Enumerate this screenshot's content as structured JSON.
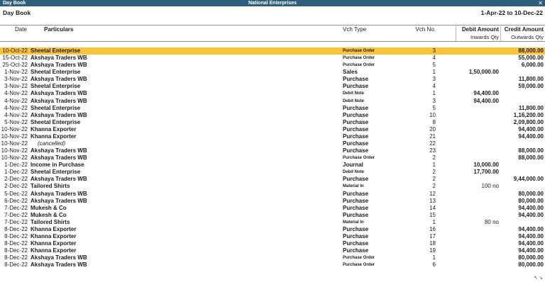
{
  "window": {
    "left_title": "Day Book",
    "company": "National Enterprises",
    "close_glyph": "✕"
  },
  "report": {
    "title": "Day Book",
    "period": "1-Apr-22 to 10-Dec-22"
  },
  "columns": {
    "date": "Date",
    "particulars": "Particulars",
    "vch_type": "Vch Type",
    "vch_no": "Vch No.",
    "debit": "Debit Amount",
    "credit": "Credit Amount",
    "debit_sub": "Inwards Qty",
    "credit_sub": "Outwards Qty"
  },
  "rows": [
    {
      "date": "10-Oct-22",
      "particulars": "Sheetal Enterprise",
      "vch_type": "Purchase Order",
      "vch_no": "3",
      "debit": "",
      "credit": "88,000.00"
    },
    {
      "date": "15-Oct-22",
      "particulars": "Akshaya Traders WB",
      "vch_type": "Purchase Order",
      "vch_no": "4",
      "debit": "",
      "credit": "55,000.00"
    },
    {
      "date": "25-Oct-22",
      "particulars": "Akshaya Traders WB",
      "vch_type": "Purchase Order",
      "vch_no": "5",
      "debit": "",
      "credit": "6,000.00"
    },
    {
      "date": "1-Nov-22",
      "particulars": "Sheetal Enterprise",
      "vch_type": "Sales",
      "vch_no": "1",
      "debit": "1,50,000.00",
      "credit": ""
    },
    {
      "date": "3-Nov-22",
      "particulars": "Akshaya Traders WB",
      "vch_type": "Purchase",
      "vch_no": "3",
      "debit": "",
      "credit": "11,800.00"
    },
    {
      "date": "3-Nov-22",
      "particulars": "Sheetal Enterprise",
      "vch_type": "Purchase",
      "vch_no": "4",
      "debit": "",
      "credit": "59,000.00"
    },
    {
      "date": "4-Nov-22",
      "particulars": "Akshaya Traders WB",
      "vch_type": "Debit Note",
      "vch_no": "1",
      "debit": "94,400.00",
      "credit": ""
    },
    {
      "date": "4-Nov-22",
      "particulars": "Akshaya Traders WB",
      "vch_type": "Debit Note",
      "vch_no": "3",
      "debit": "94,400.00",
      "credit": ""
    },
    {
      "date": "4-Nov-22",
      "particulars": "Sheetal Enterprise",
      "vch_type": "Purchase",
      "vch_no": "5",
      "debit": "",
      "credit": "11,800.00"
    },
    {
      "date": "4-Nov-22",
      "particulars": "Akshaya Traders WB",
      "vch_type": "Purchase",
      "vch_no": "10",
      "debit": "",
      "credit": "1,16,200.00"
    },
    {
      "date": "5-Nov-22",
      "particulars": "Sheetal Enterprise",
      "vch_type": "Purchase",
      "vch_no": "8",
      "debit": "",
      "credit": "2,09,800.00"
    },
    {
      "date": "10-Nov-22",
      "particulars": "Khanna Exporter",
      "vch_type": "Purchase",
      "vch_no": "20",
      "debit": "",
      "credit": "94,400.00"
    },
    {
      "date": "10-Nov-22",
      "particulars": "Khanna Exporter",
      "vch_type": "Purchase",
      "vch_no": "21",
      "debit": "",
      "credit": "94,400.00"
    },
    {
      "date": "10-Nov-22",
      "particulars": "(cancelled)",
      "vch_type": "Purchase",
      "vch_no": "22",
      "debit": "",
      "credit": ""
    },
    {
      "date": "10-Nov-22",
      "particulars": "Akshaya Traders WB",
      "vch_type": "Purchase",
      "vch_no": "23",
      "debit": "",
      "credit": "88,000.00"
    },
    {
      "date": "10-Nov-22",
      "particulars": "Akshaya Traders WB",
      "vch_type": "Purchase Order",
      "vch_no": "2",
      "debit": "",
      "credit": "88,000.00"
    },
    {
      "date": "1-Dec-22",
      "particulars": "Income in Purchase",
      "vch_type": "Journal",
      "vch_no": "1",
      "debit": "10,000.00",
      "credit": ""
    },
    {
      "date": "1-Dec-22",
      "particulars": "Sheetal Enterprise",
      "vch_type": "Debit Note",
      "vch_no": "2",
      "debit": "17,700.00",
      "credit": ""
    },
    {
      "date": "2-Dec-22",
      "particulars": "Akshaya Traders WB",
      "vch_type": "Purchase",
      "vch_no": "2",
      "debit": "",
      "credit": "9,44,000.00"
    },
    {
      "date": "2-Dec-22",
      "particulars": "Tailored Shirts",
      "vch_type": "Material In",
      "vch_no": "2",
      "debit": "100 no",
      "credit": ""
    },
    {
      "date": "5-Dec-22",
      "particulars": "Akshaya Traders WB",
      "vch_type": "Purchase",
      "vch_no": "12",
      "debit": "",
      "credit": "80,000.00"
    },
    {
      "date": "6-Dec-22",
      "particulars": "Akshaya Traders WB",
      "vch_type": "Purchase",
      "vch_no": "13",
      "debit": "",
      "credit": "80,000.00"
    },
    {
      "date": "7-Dec-22",
      "particulars": "Mukesh & Co",
      "vch_type": "Purchase",
      "vch_no": "14",
      "debit": "",
      "credit": "94,400.00"
    },
    {
      "date": "7-Dec-22",
      "particulars": "Mukesh & Co",
      "vch_type": "Purchase",
      "vch_no": "15",
      "debit": "",
      "credit": "94,400.00"
    },
    {
      "date": "7-Dec-22",
      "particulars": "Tailored Shirts",
      "vch_type": "Material In",
      "vch_no": "1",
      "debit": "80 no",
      "credit": ""
    },
    {
      "date": "8-Dec-22",
      "particulars": "Khanna Exporter",
      "vch_type": "Purchase",
      "vch_no": "16",
      "debit": "",
      "credit": "94,400.00"
    },
    {
      "date": "8-Dec-22",
      "particulars": "Khanna Exporter",
      "vch_type": "Purchase",
      "vch_no": "17",
      "debit": "",
      "credit": "94,400.00"
    },
    {
      "date": "8-Dec-22",
      "particulars": "Khanna Exporter",
      "vch_type": "Purchase",
      "vch_no": "18",
      "debit": "",
      "credit": "94,400.00"
    },
    {
      "date": "8-Dec-22",
      "particulars": "Khanna Exporter",
      "vch_type": "Purchase",
      "vch_no": "19",
      "debit": "",
      "credit": "94,400.00"
    },
    {
      "date": "8-Dec-22",
      "particulars": "Akshaya Traders WB",
      "vch_type": "Purchase Order",
      "vch_no": "1",
      "debit": "",
      "credit": "80,000.00"
    },
    {
      "date": "8-Dec-22",
      "particulars": "Akshaya Traders WB",
      "vch_type": "Purchase Order",
      "vch_no": "6",
      "debit": "",
      "credit": "80,000.00"
    }
  ],
  "scroll_glyph": "↖↘",
  "colors": {
    "titlebar": "#2f5d7c",
    "selected_row": "#fcc33b"
  }
}
